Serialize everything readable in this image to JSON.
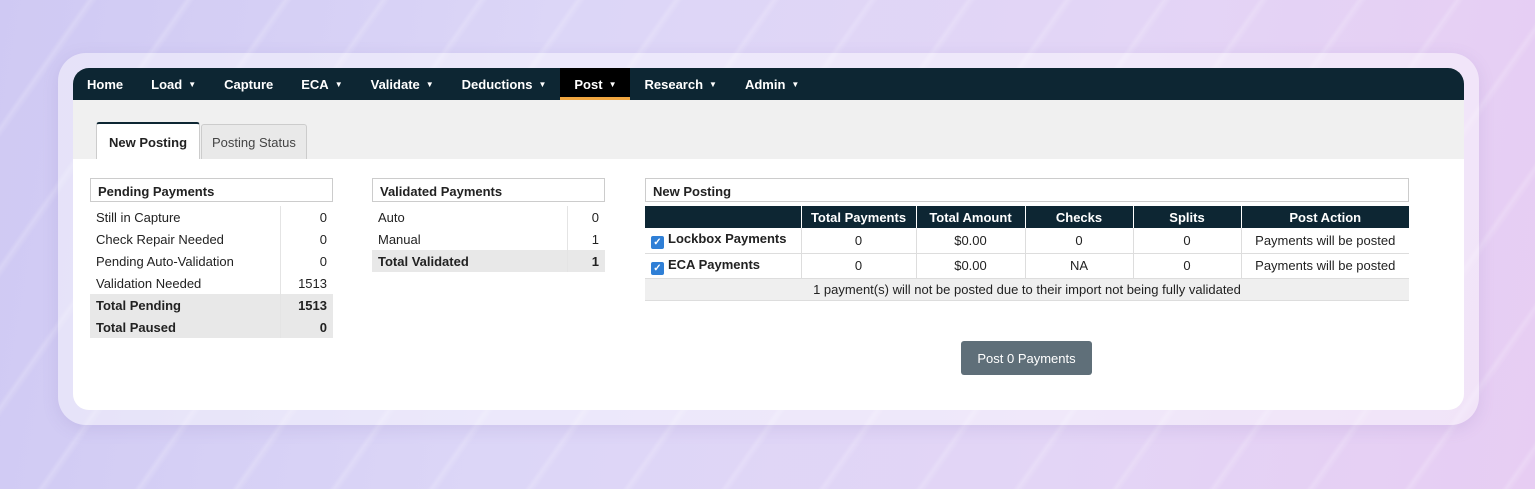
{
  "nav": {
    "items": [
      {
        "label": "Home",
        "caret": false
      },
      {
        "label": "Load",
        "caret": true
      },
      {
        "label": "Capture",
        "caret": false
      },
      {
        "label": "ECA",
        "caret": true
      },
      {
        "label": "Validate",
        "caret": true
      },
      {
        "label": "Deductions",
        "caret": true
      },
      {
        "label": "Post",
        "caret": true,
        "active": true
      },
      {
        "label": "Research",
        "caret": true
      },
      {
        "label": "Admin",
        "caret": true
      }
    ],
    "caret_glyph": "▼"
  },
  "tabs": {
    "new_posting": "New Posting",
    "posting_status": "Posting Status"
  },
  "pending": {
    "title": "Pending Payments",
    "rows": [
      {
        "label": "Still in Capture",
        "value": "0"
      },
      {
        "label": "Check Repair Needed",
        "value": "0"
      },
      {
        "label": "Pending Auto-Validation",
        "value": "0"
      },
      {
        "label": "Validation Needed",
        "value": "1513"
      }
    ],
    "totals": [
      {
        "label": "Total Pending",
        "value": "1513"
      },
      {
        "label": "Total Paused",
        "value": "0"
      }
    ]
  },
  "validated": {
    "title": "Validated Payments",
    "rows": [
      {
        "label": "Auto",
        "value": "0"
      },
      {
        "label": "Manual",
        "value": "1"
      }
    ],
    "totals": [
      {
        "label": "Total Validated",
        "value": "1"
      }
    ]
  },
  "new_posting": {
    "title": "New Posting",
    "headers": [
      "",
      "Total Payments",
      "Total Amount",
      "Checks",
      "Splits",
      "Post Action"
    ],
    "rows": [
      {
        "label": "Lockbox Payments",
        "checked": true,
        "total_payments": "0",
        "total_amount": "$0.00",
        "checks": "0",
        "splits": "0",
        "post_action": "Payments will be posted"
      },
      {
        "label": "ECA Payments",
        "checked": true,
        "total_payments": "0",
        "total_amount": "$0.00",
        "checks": "NA",
        "splits": "0",
        "post_action": "Payments will be posted"
      }
    ],
    "note": "1 payment(s) will not be posted due to their import not being fully validated",
    "post_button": "Post 0 Payments"
  },
  "colors": {
    "navbar": "#0d2633",
    "active_accent": "#f0a640",
    "button": "#5f6f79",
    "checkbox": "#2f7fd6"
  }
}
